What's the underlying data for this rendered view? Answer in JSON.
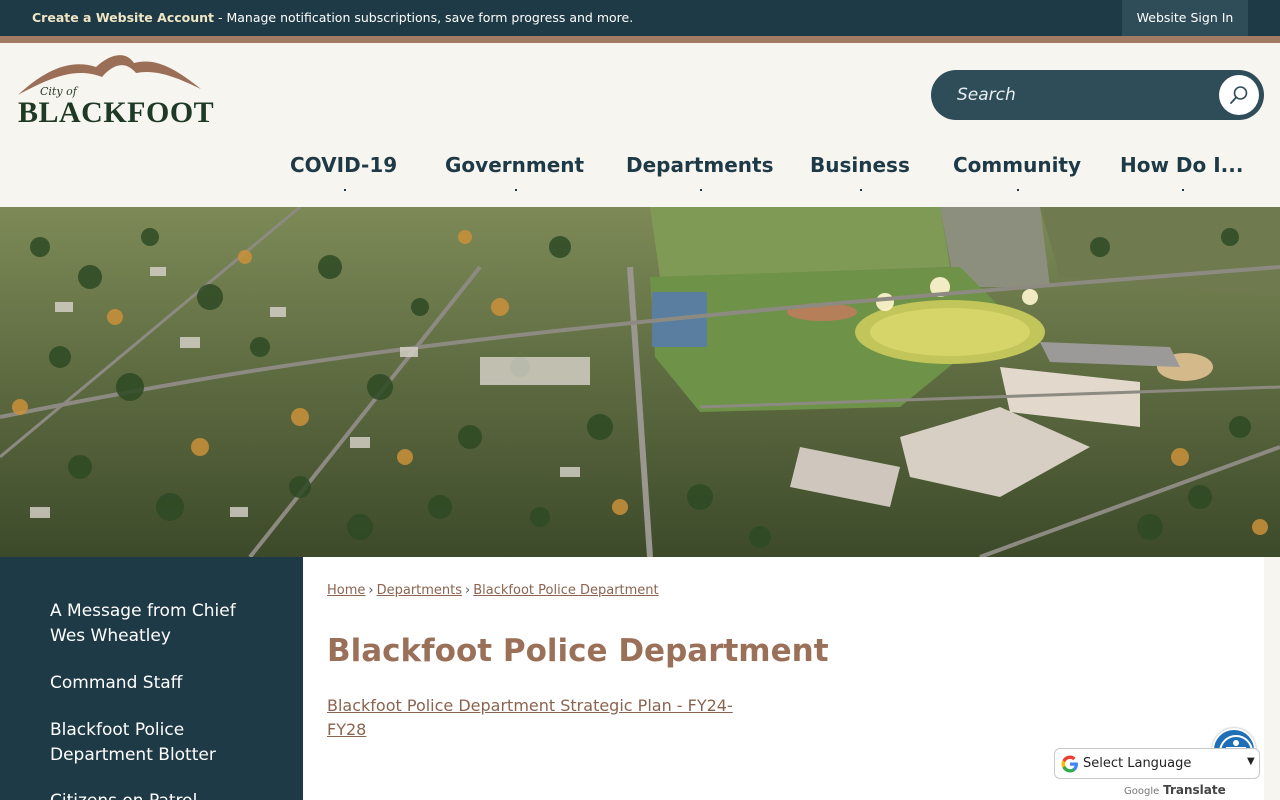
{
  "topbar": {
    "create_account": "Create a Website Account",
    "create_account_rest": " - Manage notification subscriptions, save form progress and more.",
    "sign_in": "Website Sign In"
  },
  "logo": {
    "small": "City of",
    "big": "BLACKFOOT"
  },
  "search": {
    "placeholder": "Search",
    "icon": "search-icon"
  },
  "nav": {
    "items": [
      "COVID-19",
      "Government",
      "Departments",
      "Business",
      "Community",
      "How Do I..."
    ]
  },
  "sidebar": {
    "items": [
      "A Message from Chief Wes Wheatley",
      "Command Staff",
      "Blackfoot Police Department Blotter",
      "Citizens on Patrol"
    ]
  },
  "breadcrumb": {
    "items": [
      "Home",
      "Departments",
      "Blackfoot Police Department"
    ],
    "separator": "›"
  },
  "main": {
    "title": "Blackfoot Police Department",
    "link": "Blackfoot Police Department Strategic Plan - FY24-FY28"
  },
  "translate": {
    "label": "Select Language",
    "powered_google": "Google",
    "powered_translate": "Translate"
  },
  "colors": {
    "navy": "#1e3a46",
    "accent": "#a37a62",
    "title_brown": "#9a7058"
  }
}
